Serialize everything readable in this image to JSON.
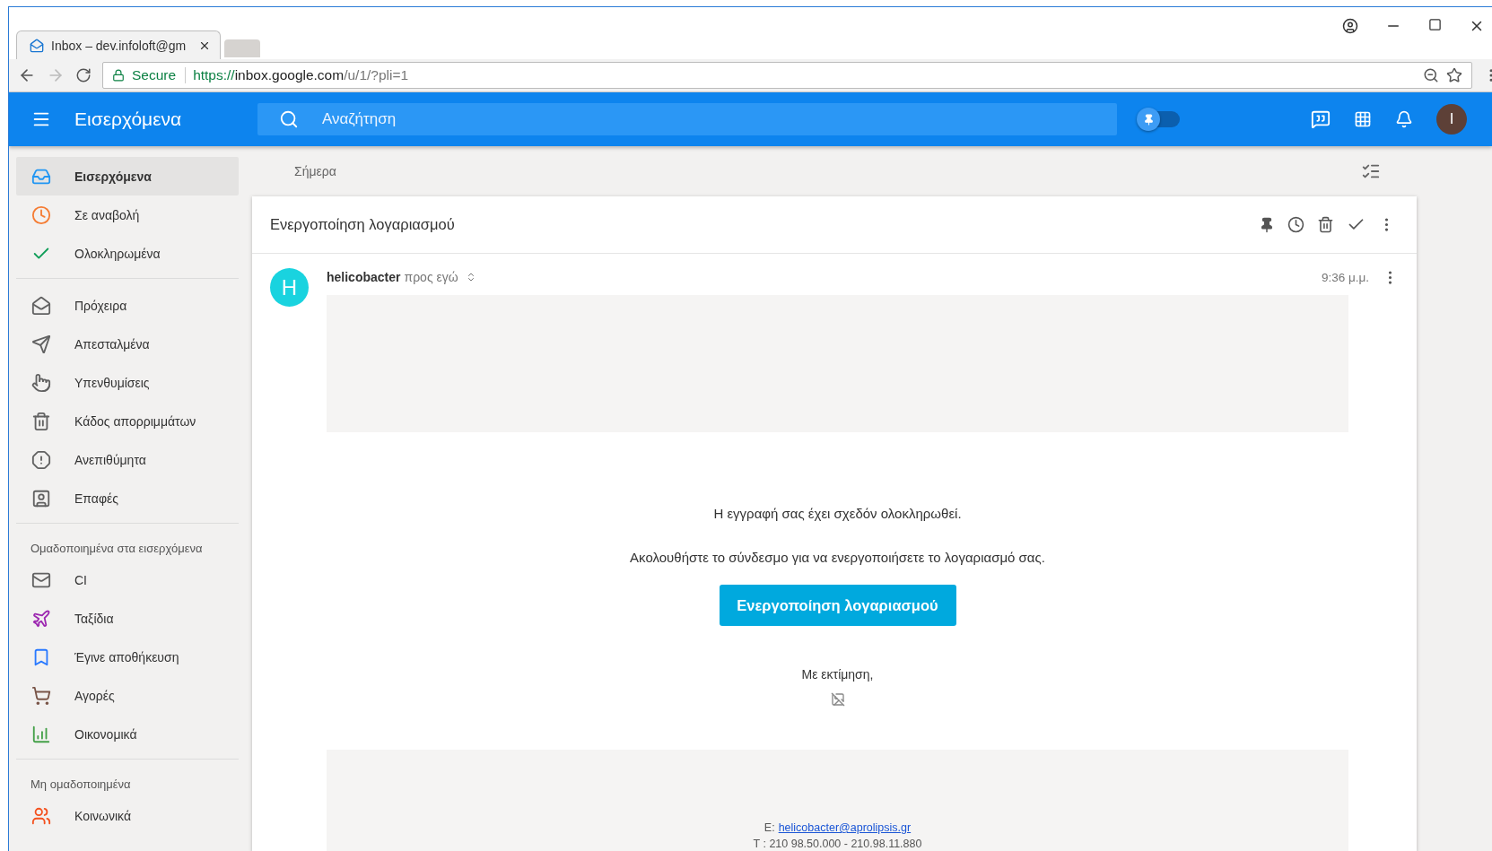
{
  "browser": {
    "tab_title": "Inbox – dev.infoloft@gm",
    "secure_label": "Secure",
    "url": [
      {
        "kind": "scheme",
        "text": "https://"
      },
      {
        "kind": "host",
        "text": "inbox.google.com"
      },
      {
        "kind": "path",
        "text": "/u/1/?pli=1"
      }
    ]
  },
  "app_bar": {
    "title": "Εισερχόμενα",
    "search": {
      "placeholder": "Αναζήτηση"
    },
    "pin_toggle": {
      "on": false
    },
    "avatar": "I"
  },
  "sidebar": [
    {
      "items": [
        {
          "kind": "inbox",
          "label": "Εισερχόμενα",
          "selected": true,
          "color": "#2196f3"
        },
        {
          "kind": "clock",
          "label": "Σε αναβολή",
          "selected": false,
          "color": "#f57c33"
        },
        {
          "kind": "done",
          "label": "Ολοκληρωμένα",
          "selected": false,
          "color": "#0f9d58"
        }
      ]
    },
    {
      "items": [
        {
          "kind": "drafts",
          "label": "Πρόχειρα",
          "selected": false,
          "color": "#616161"
        },
        {
          "kind": "sent",
          "label": "Απεσταλμένα",
          "selected": false,
          "color": "#616161"
        },
        {
          "kind": "reminder",
          "label": "Υπενθυμίσεις",
          "selected": false,
          "color": "#616161"
        },
        {
          "kind": "trash",
          "label": "Κάδος απορριμμάτων",
          "selected": false,
          "color": "#616161"
        },
        {
          "kind": "spam",
          "label": "Ανεπιθύμητα",
          "selected": false,
          "color": "#616161"
        },
        {
          "kind": "contacts",
          "label": "Επαφές",
          "selected": false,
          "color": "#616161"
        }
      ]
    },
    {
      "heading": "Ομαδοποιημένα στα εισερχόμενα",
      "items": [
        {
          "kind": "mail",
          "label": "CI",
          "selected": false,
          "color": "#616161"
        },
        {
          "kind": "travel",
          "label": "Ταξίδια",
          "selected": false,
          "color": "#9c27b0"
        },
        {
          "kind": "saved",
          "label": "Έγινε αποθήκευση",
          "selected": false,
          "color": "#2979ff"
        },
        {
          "kind": "purchases",
          "label": "Αγορές",
          "selected": false,
          "color": "#795548"
        },
        {
          "kind": "finance",
          "label": "Οικονομικά",
          "selected": false,
          "color": "#43a047"
        }
      ]
    },
    {
      "heading": "Μη ομαδοποιημένα",
      "items": [
        {
          "kind": "social",
          "label": "Κοινωνικά",
          "selected": false,
          "color": "#f4511e"
        }
      ]
    }
  ],
  "day_label": "Σήμερα",
  "email": {
    "subject": "Ενεργοποίηση λογαριασμού",
    "sender_initial": "H",
    "sender": "helicobacter",
    "recipient": "προς εγώ",
    "time": "9:36 μ.μ.",
    "body": {
      "lines": [
        "Η εγγραφή σας έχει σχεδόν ολοκληρωθεί.",
        "Ακολουθήστε το σύνδεσμο για να ενεργοποιήσετε το λογαριασμό σας."
      ],
      "button": "Ενεργοποίηση λογαριασμού",
      "signoff": "Με εκτίμηση,"
    },
    "footer": {
      "email_label": "E:",
      "email_link": "helicobacter@aprolipsis.gr",
      "phone": "T : 210 98.50.000 - 210.98.11.880"
    }
  }
}
